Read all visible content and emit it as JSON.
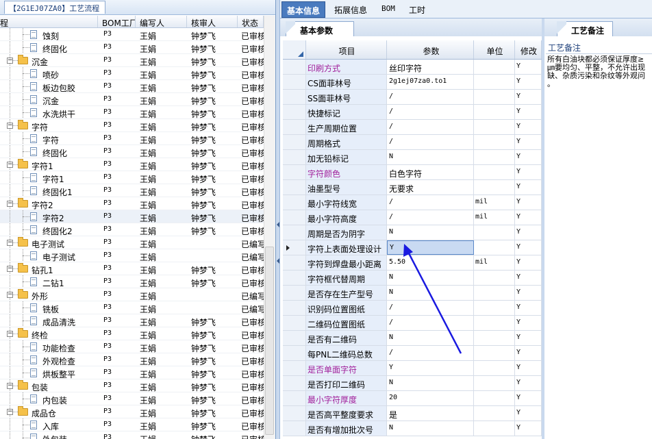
{
  "left_panel": {
    "tab_title": "【2G1EJ07ZA0】工艺流程",
    "columns": [
      "程",
      "BOM工厂",
      "编写人",
      "核审人",
      "状态"
    ],
    "rows": [
      {
        "level": 2,
        "type": "doc",
        "name": "蚀刻",
        "factory": "P3",
        "writer": "王娟",
        "reviewer": "钟梦飞",
        "status": "已审核"
      },
      {
        "level": 2,
        "type": "doc",
        "name": "终固化",
        "factory": "P3",
        "writer": "王娟",
        "reviewer": "钟梦飞",
        "status": "已审核"
      },
      {
        "level": 1,
        "type": "folder",
        "name": "沉金",
        "factory": "P3",
        "writer": "王娟",
        "reviewer": "钟梦飞",
        "status": "已审核"
      },
      {
        "level": 2,
        "type": "doc",
        "name": "喷砂",
        "factory": "P3",
        "writer": "王娟",
        "reviewer": "钟梦飞",
        "status": "已审核"
      },
      {
        "level": 2,
        "type": "doc",
        "name": "板边包胶",
        "factory": "P3",
        "writer": "王娟",
        "reviewer": "钟梦飞",
        "status": "已审核"
      },
      {
        "level": 2,
        "type": "doc",
        "name": "沉金",
        "factory": "P3",
        "writer": "王娟",
        "reviewer": "钟梦飞",
        "status": "已审核"
      },
      {
        "level": 2,
        "type": "doc",
        "name": "水洗烘干",
        "factory": "P3",
        "writer": "王娟",
        "reviewer": "钟梦飞",
        "status": "已审核"
      },
      {
        "level": 1,
        "type": "folder",
        "name": "字符",
        "factory": "P3",
        "writer": "王娟",
        "reviewer": "钟梦飞",
        "status": "已审核"
      },
      {
        "level": 2,
        "type": "doc",
        "name": "字符",
        "factory": "P3",
        "writer": "王娟",
        "reviewer": "钟梦飞",
        "status": "已审核"
      },
      {
        "level": 2,
        "type": "doc",
        "name": "终固化",
        "factory": "P3",
        "writer": "王娟",
        "reviewer": "钟梦飞",
        "status": "已审核"
      },
      {
        "level": 1,
        "type": "folder",
        "name": "字符1",
        "factory": "P3",
        "writer": "王娟",
        "reviewer": "钟梦飞",
        "status": "已审核"
      },
      {
        "level": 2,
        "type": "doc",
        "name": "字符1",
        "factory": "P3",
        "writer": "王娟",
        "reviewer": "钟梦飞",
        "status": "已审核"
      },
      {
        "level": 2,
        "type": "doc",
        "name": "终固化1",
        "factory": "P3",
        "writer": "王娟",
        "reviewer": "钟梦飞",
        "status": "已审核"
      },
      {
        "level": 1,
        "type": "folder",
        "name": "字符2",
        "factory": "P3",
        "writer": "王娟",
        "reviewer": "钟梦飞",
        "status": "已审核"
      },
      {
        "level": 2,
        "type": "doc",
        "name": "字符2",
        "factory": "P3",
        "writer": "王娟",
        "reviewer": "钟梦飞",
        "status": "已审核",
        "selected": true
      },
      {
        "level": 2,
        "type": "doc",
        "name": "终固化2",
        "factory": "P3",
        "writer": "王娟",
        "reviewer": "钟梦飞",
        "status": "已审核"
      },
      {
        "level": 1,
        "type": "folder",
        "name": "电子测试",
        "factory": "P3",
        "writer": "王娟",
        "reviewer": "",
        "status": "已编写"
      },
      {
        "level": 2,
        "type": "doc",
        "name": "电子测试",
        "factory": "P3",
        "writer": "王娟",
        "reviewer": "",
        "status": "已编写"
      },
      {
        "level": 1,
        "type": "folder",
        "name": "钻孔1",
        "factory": "P3",
        "writer": "王娟",
        "reviewer": "钟梦飞",
        "status": "已审核"
      },
      {
        "level": 2,
        "type": "doc",
        "name": "二钻1",
        "factory": "P3",
        "writer": "王娟",
        "reviewer": "钟梦飞",
        "status": "已审核"
      },
      {
        "level": 1,
        "type": "folder",
        "name": "外形",
        "factory": "P3",
        "writer": "王娟",
        "reviewer": "",
        "status": "已编写"
      },
      {
        "level": 2,
        "type": "doc",
        "name": "铣板",
        "factory": "P3",
        "writer": "王娟",
        "reviewer": "",
        "status": "已编写"
      },
      {
        "level": 2,
        "type": "doc",
        "name": "成品清洗",
        "factory": "P3",
        "writer": "王娟",
        "reviewer": "钟梦飞",
        "status": "已审核"
      },
      {
        "level": 1,
        "type": "folder",
        "name": "终检",
        "factory": "P3",
        "writer": "王娟",
        "reviewer": "钟梦飞",
        "status": "已审核"
      },
      {
        "level": 2,
        "type": "doc",
        "name": "功能检查",
        "factory": "P3",
        "writer": "王娟",
        "reviewer": "钟梦飞",
        "status": "已审核"
      },
      {
        "level": 2,
        "type": "doc",
        "name": "外观检查",
        "factory": "P3",
        "writer": "王娟",
        "reviewer": "钟梦飞",
        "status": "已审核"
      },
      {
        "level": 2,
        "type": "doc",
        "name": "烘板整平",
        "factory": "P3",
        "writer": "王娟",
        "reviewer": "钟梦飞",
        "status": "已审核"
      },
      {
        "level": 1,
        "type": "folder",
        "name": "包装",
        "factory": "P3",
        "writer": "王娟",
        "reviewer": "钟梦飞",
        "status": "已审核"
      },
      {
        "level": 2,
        "type": "doc",
        "name": "内包装",
        "factory": "P3",
        "writer": "王娟",
        "reviewer": "钟梦飞",
        "status": "已审核"
      },
      {
        "level": 1,
        "type": "folder",
        "name": "成品仓",
        "factory": "P3",
        "writer": "王娟",
        "reviewer": "钟梦飞",
        "status": "已审核"
      },
      {
        "level": 2,
        "type": "doc",
        "name": "入库",
        "factory": "P3",
        "writer": "王娟",
        "reviewer": "钟梦飞",
        "status": "已审核"
      },
      {
        "level": 2,
        "type": "doc",
        "name": "外包装",
        "factory": "P3",
        "writer": "王娟",
        "reviewer": "钟梦飞",
        "status": "已审核"
      }
    ]
  },
  "top_tabs": [
    "基本信息",
    "拓展信息",
    "BOM",
    "工时"
  ],
  "sub_tab": "基本参数",
  "params": {
    "columns": [
      "项目",
      "参数",
      "单位",
      "修改"
    ],
    "rows": [
      {
        "item": "印刷方式",
        "value": "丝印字符",
        "unit": "",
        "mod": "Y",
        "highlight": true
      },
      {
        "item": "CS面菲林号",
        "value": "2g1ej07za0.to1",
        "unit": "",
        "mod": "Y"
      },
      {
        "item": "SS面菲林号",
        "value": "/",
        "unit": "",
        "mod": "Y"
      },
      {
        "item": "快捷标记",
        "value": "/",
        "unit": "",
        "mod": "Y"
      },
      {
        "item": "生产周期位置",
        "value": "/",
        "unit": "",
        "mod": "Y"
      },
      {
        "item": "周期格式",
        "value": "/",
        "unit": "",
        "mod": "Y"
      },
      {
        "item": "加无铅标记",
        "value": "N",
        "unit": "",
        "mod": "Y"
      },
      {
        "item": "字符颜色",
        "value": "白色字符",
        "unit": "",
        "mod": "Y",
        "highlight": true
      },
      {
        "item": "油墨型号",
        "value": "无要求",
        "unit": "",
        "mod": "Y"
      },
      {
        "item": "最小字符线宽",
        "value": "/",
        "unit": "mil",
        "mod": "Y"
      },
      {
        "item": "最小字符高度",
        "value": "/",
        "unit": "mil",
        "mod": "Y"
      },
      {
        "item": "周期是否为阴字",
        "value": "N",
        "unit": "",
        "mod": "Y"
      },
      {
        "item": "字符上表面处理设计",
        "value": "Y",
        "unit": "",
        "mod": "Y",
        "current": true
      },
      {
        "item": "字符到焊盘最小距离",
        "value": "5.50",
        "unit": "mil",
        "mod": "Y"
      },
      {
        "item": "字符框代替周期",
        "value": "N",
        "unit": "",
        "mod": "Y"
      },
      {
        "item": "是否存在生产型号",
        "value": "N",
        "unit": "",
        "mod": "Y"
      },
      {
        "item": "识别码位置图纸",
        "value": "/",
        "unit": "",
        "mod": "Y"
      },
      {
        "item": "二维码位置图纸",
        "value": "/",
        "unit": "",
        "mod": "Y"
      },
      {
        "item": "是否有二维码",
        "value": "N",
        "unit": "",
        "mod": "Y"
      },
      {
        "item": "每PNL二维码总数",
        "value": "/",
        "unit": "",
        "mod": "Y"
      },
      {
        "item": "是否单面字符",
        "value": "Y",
        "unit": "",
        "mod": "Y",
        "highlight": true
      },
      {
        "item": "是否打印二维码",
        "value": "N",
        "unit": "",
        "mod": "Y"
      },
      {
        "item": "最小字符厚度",
        "value": "20",
        "unit": "",
        "mod": "Y",
        "highlight": true
      },
      {
        "item": "是否高平整度要求",
        "value": "是",
        "unit": "",
        "mod": "Y"
      },
      {
        "item": "是否有增加批次号",
        "value": "N",
        "unit": "",
        "mod": "Y"
      }
    ]
  },
  "remarks": {
    "tab": "工艺备注",
    "label": "工艺备注",
    "text": "所有白油块都必须保证厚度≥\n㎛要均匀、平整，不允许出现\n缺、杂质污染和杂纹等外观问\n。"
  },
  "colors": {
    "accent": "#4a7bbf",
    "highlight_text": "#a1209b",
    "arrow": "#1a1ae0"
  }
}
